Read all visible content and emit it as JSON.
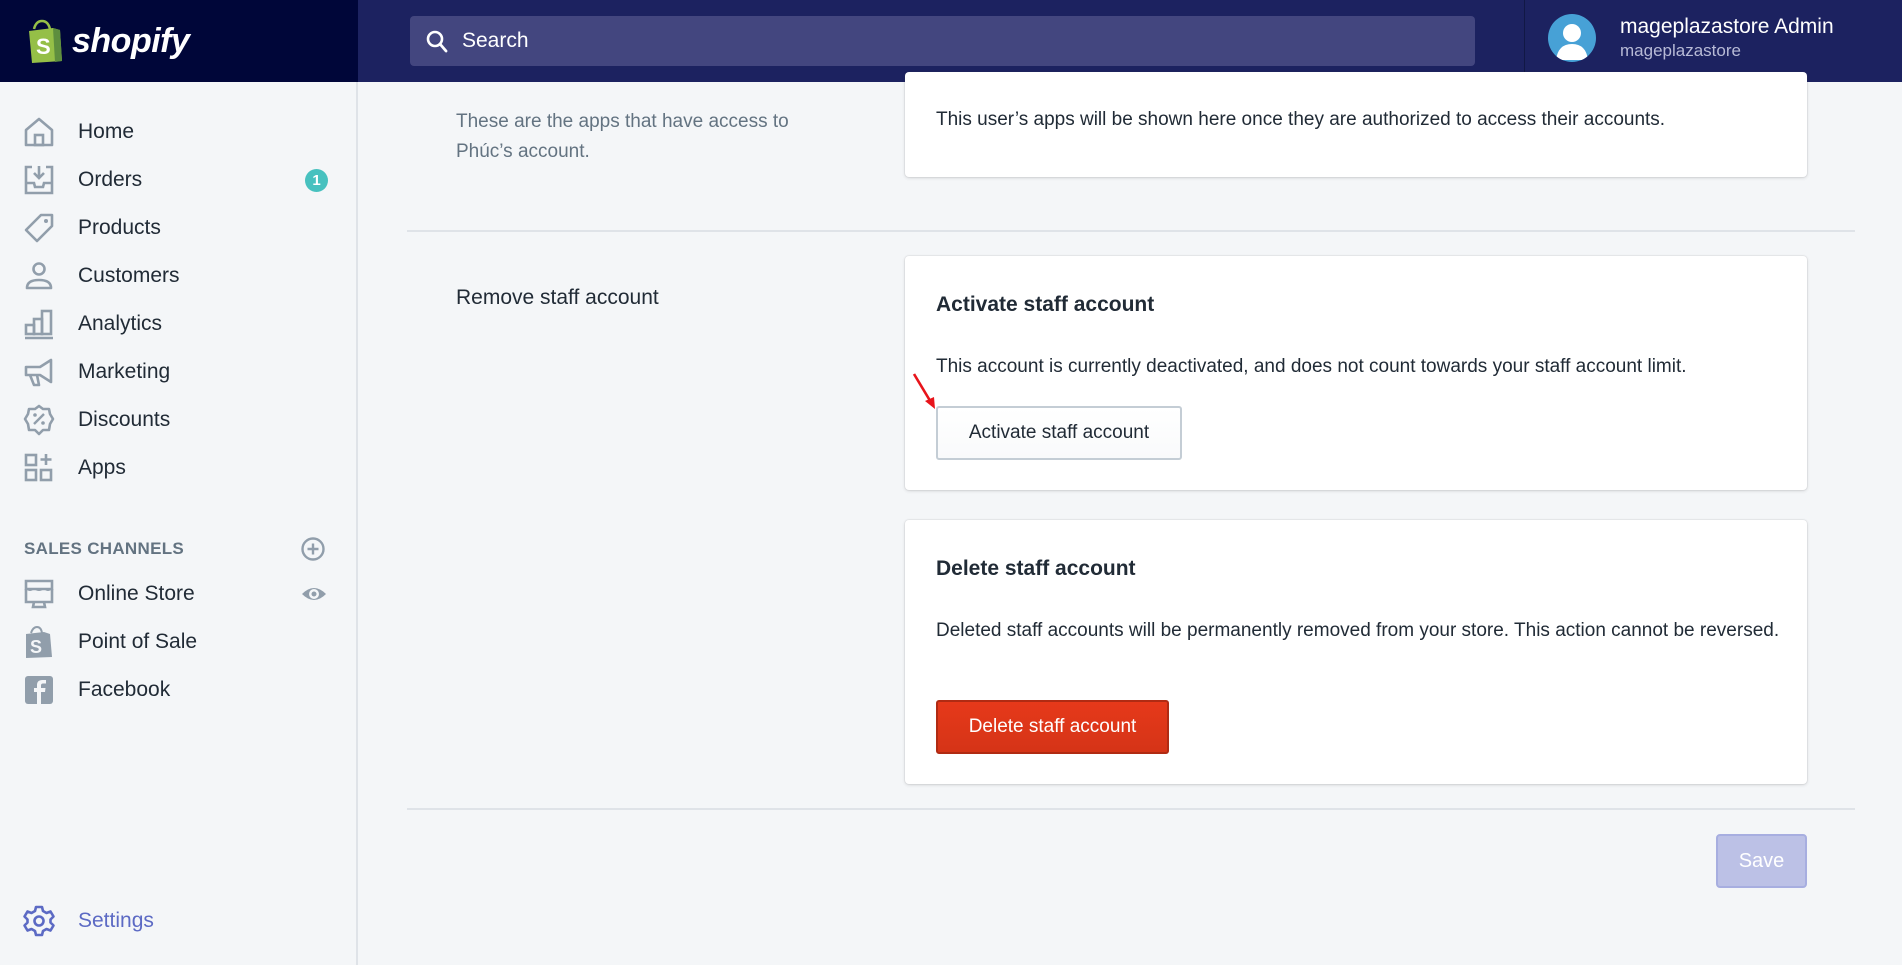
{
  "header": {
    "brand_name": "shopify",
    "search_placeholder": "Search",
    "user": {
      "name": "mageplazastore Admin",
      "store": "mageplazastore"
    }
  },
  "sidebar": {
    "items": [
      {
        "label": "Home",
        "icon": "home-icon"
      },
      {
        "label": "Orders",
        "icon": "orders-icon",
        "badge": "1"
      },
      {
        "label": "Products",
        "icon": "tag-icon"
      },
      {
        "label": "Customers",
        "icon": "person-icon"
      },
      {
        "label": "Analytics",
        "icon": "bar-chart-icon"
      },
      {
        "label": "Marketing",
        "icon": "megaphone-icon"
      },
      {
        "label": "Discounts",
        "icon": "discount-icon"
      },
      {
        "label": "Apps",
        "icon": "apps-icon"
      }
    ],
    "sales_channels": {
      "heading": "SALES CHANNELS",
      "items": [
        {
          "label": "Online Store",
          "icon": "store-icon"
        },
        {
          "label": "Point of Sale",
          "icon": "shopify-bag-icon"
        },
        {
          "label": "Facebook",
          "icon": "facebook-icon"
        }
      ]
    },
    "settings_label": "Settings"
  },
  "main": {
    "apps_section": {
      "description": "These are the apps that have access to Phúc’s account.",
      "card_text": "This user’s apps will be shown here once they are authorized to access their accounts."
    },
    "remove_section": {
      "title": "Remove staff account",
      "activate_card": {
        "heading": "Activate staff account",
        "text": "This account is currently deactivated, and does not count towards your staff account limit.",
        "button_label": "Activate staff account"
      },
      "delete_card": {
        "heading": "Delete staff account",
        "text": "Deleted staff accounts will be permanently removed from your store. This action cannot be reversed.",
        "button_label": "Delete staff account"
      }
    },
    "save_label": "Save"
  },
  "colors": {
    "topbar": "#1c2260",
    "brand_bg": "#000639",
    "search_bg": "#43467f",
    "badge": "#47c1bf",
    "settings_accent": "#5c6ac4",
    "danger": "#de3618",
    "save_disabled": "#bcc1e6"
  }
}
